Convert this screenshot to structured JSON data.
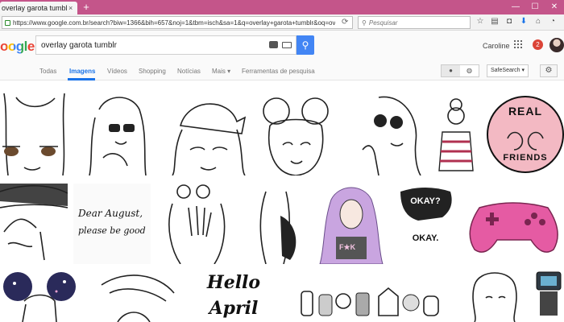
{
  "browser": {
    "tab_title": "overlay garota tumblr - Pe...",
    "tab_close": "×",
    "new_tab": "+",
    "url": "https://www.google.com.br/search?biw=1366&bih=657&noj=1&tbm=isch&sa=1&q=overlay+garota+tumblr&oq=overlay+garota+tun",
    "search_placeholder": "Pesquisar",
    "window_minimize": "—",
    "window_maximize": "☐",
    "window_close": "✕"
  },
  "google": {
    "logo_text": "oogle",
    "query": "overlay garota tumblr",
    "user_name": "Caroline",
    "notification_count": "2"
  },
  "nav": {
    "tabs": [
      "Todas",
      "Imagens",
      "Vídeos",
      "Shopping",
      "Notícias",
      "Mais ▾",
      "Ferramentas de pesquisa"
    ],
    "active_tab": "Imagens",
    "safesearch": "SafeSearch ▾"
  },
  "results": {
    "real_friends": [
      "REAL",
      "FRIENDS"
    ],
    "dear_august": [
      "Dear August,",
      "please be good"
    ],
    "okay_top": "OKAY?",
    "okay_bottom": "OKAY.",
    "fk_shirt": "F★K",
    "hello_april": [
      "Hello",
      "April"
    ]
  },
  "colors": {
    "titlebar": "#c4558a",
    "accent": "#1a73e8",
    "search_button": "#4285f4",
    "badge": "#db4437"
  }
}
